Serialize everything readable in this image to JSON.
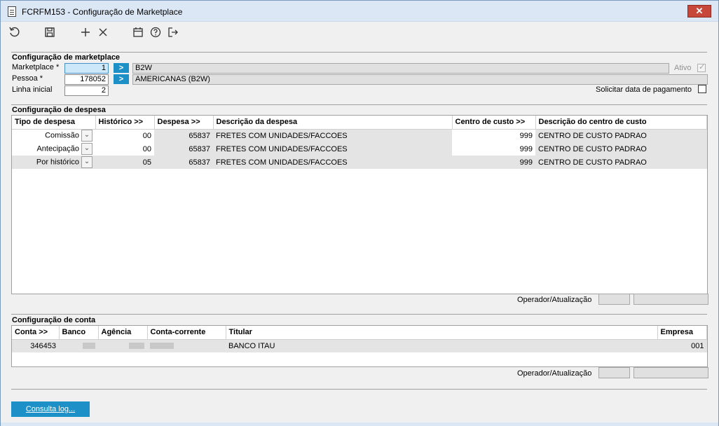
{
  "window": {
    "title": "FCRFM153 - Configuração de Marketplace",
    "close_label": "✕"
  },
  "toolbar": {
    "icons": [
      "refresh-icon",
      "save-icon",
      "add-icon",
      "delete-icon",
      "calendar-icon",
      "help-icon",
      "exit-icon"
    ]
  },
  "marketplace_section": {
    "title": "Configuração de marketplace",
    "marketplace_label": "Marketplace *",
    "marketplace_value": "1",
    "marketplace_desc": "B2W",
    "pessoa_label": "Pessoa *",
    "pessoa_value": "178052",
    "pessoa_desc": "AMERICANAS (B2W)",
    "linha_label": "Linha inicial",
    "linha_value": "2",
    "ativo_label": "Ativo",
    "solicitar_label": "Solicitar data de pagamento"
  },
  "despesa_section": {
    "title": "Configuração de despesa",
    "headers": [
      "Tipo de despesa",
      "Histórico >>",
      "Despesa >>",
      "Descrição da despesa",
      "Centro de custo >>",
      "Descrição do centro de custo"
    ],
    "rows": [
      {
        "tipo": "Comissão",
        "historico": "00",
        "despesa": "65837",
        "descricao": "FRETES COM UNIDADES/FACCOES",
        "centro": "999",
        "desc_centro": "CENTRO DE CUSTO PADRAO"
      },
      {
        "tipo": "Antecipação",
        "historico": "00",
        "despesa": "65837",
        "descricao": "FRETES COM UNIDADES/FACCOES",
        "centro": "999",
        "desc_centro": "CENTRO DE CUSTO PADRAO"
      },
      {
        "tipo": "Por histórico",
        "historico": "05",
        "despesa": "65837",
        "descricao": "FRETES COM UNIDADES/FACCOES",
        "centro": "999",
        "desc_centro": "CENTRO DE CUSTO PADRAO"
      }
    ],
    "operador_label": "Operador/Atualização"
  },
  "conta_section": {
    "title": "Configuração de conta",
    "headers": [
      "Conta >>",
      "Banco",
      "Agência",
      "Conta-corrente",
      "Titular",
      "Empresa"
    ],
    "rows": [
      {
        "conta": "346453",
        "titular": "BANCO ITAU",
        "empresa": "001"
      }
    ],
    "operador_label": "Operador/Atualização"
  },
  "consulta_log_label": "Consulta log..."
}
